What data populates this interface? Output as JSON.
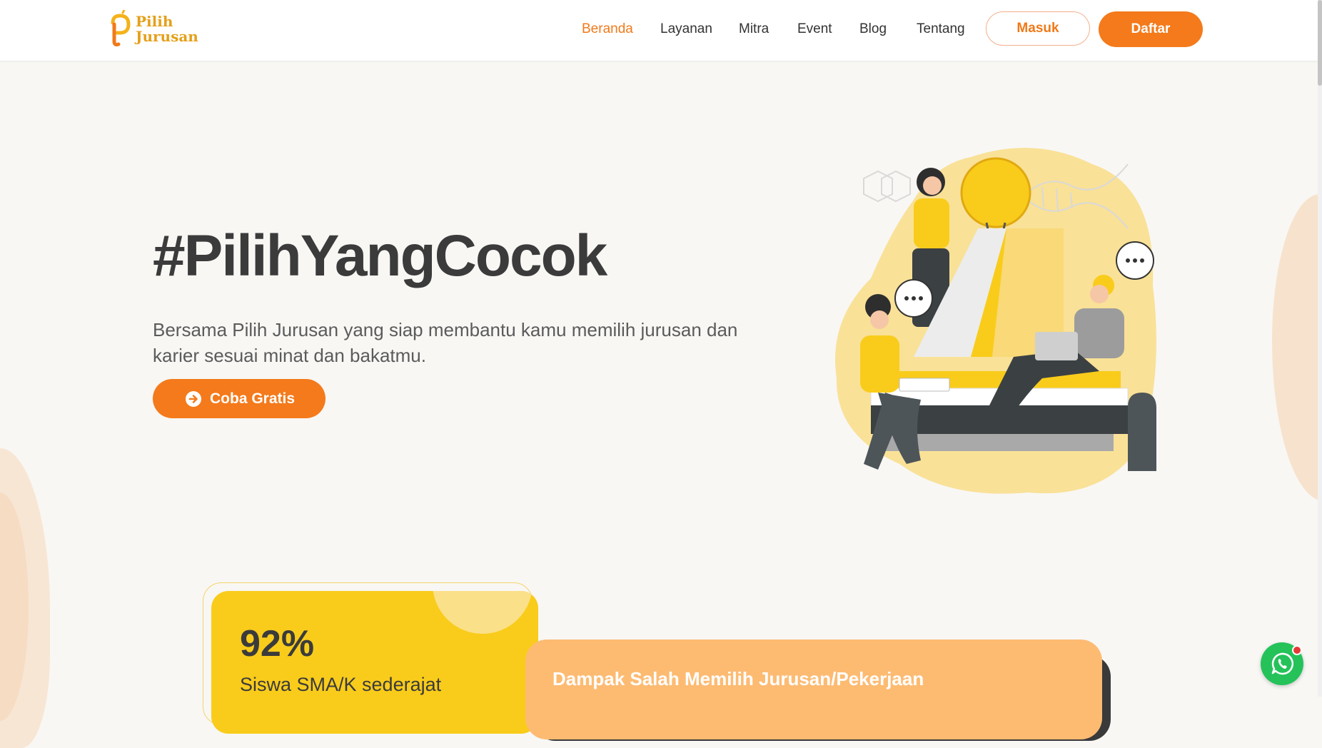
{
  "brand": {
    "name_line1": "Pilih",
    "name_line2": "Jurusan",
    "color": "#e5a01a"
  },
  "nav": {
    "items": [
      {
        "label": "Beranda",
        "active": true
      },
      {
        "label": "Layanan",
        "active": false
      },
      {
        "label": "Mitra",
        "active": false
      },
      {
        "label": "Event",
        "active": false
      },
      {
        "label": "Blog",
        "active": false
      },
      {
        "label": "Tentang",
        "active": false
      }
    ],
    "login_label": "Masuk",
    "register_label": "Daftar"
  },
  "hero": {
    "title": "#PilihYangCocok",
    "subtitle": "Bersama Pilih Jurusan yang siap membantu kamu memilih jurusan dan karier sesuai minat dan bakatmu.",
    "cta_label": "Coba Gratis",
    "cta_icon": "arrow-circle-right-icon",
    "illustration": "students-lightbulb-illustration"
  },
  "stats": {
    "value": "92%",
    "label": "Siswa SMA/K sederajat"
  },
  "impact": {
    "title": "Dampak Salah Memilih Jurusan/Pekerjaan"
  },
  "floating": {
    "whatsapp_icon": "whatsapp-icon"
  },
  "colors": {
    "primary": "#f47a1b",
    "yellow": "#f9cc1b",
    "peach": "#fdbb72",
    "text": "#3b3b3b",
    "background": "#f8f7f4",
    "whatsapp": "#25c25a"
  }
}
